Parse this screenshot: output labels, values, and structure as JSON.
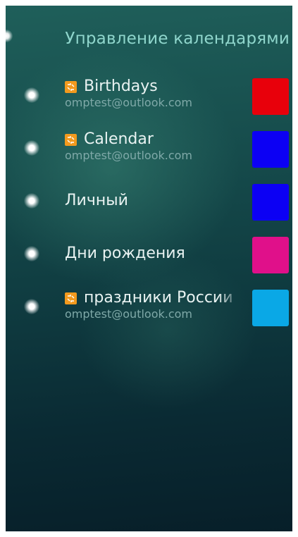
{
  "header": {
    "title": "Управление календарями"
  },
  "calendars": [
    {
      "name": "Birthdays",
      "account": "omptest@outlook.com",
      "icon": "exchange-icon",
      "color": "#e8000b"
    },
    {
      "name": "Calendar",
      "account": "omptest@outlook.com",
      "icon": "exchange-icon",
      "color": "#0c00f4"
    },
    {
      "name": "Личный",
      "account": "",
      "icon": "",
      "color": "#0c00f4"
    },
    {
      "name": "Дни рождения",
      "account": "",
      "icon": "",
      "color": "#e0108a"
    },
    {
      "name": "праздники России",
      "account": "omptest@outlook.com",
      "icon": "exchange-icon",
      "color": "#0aa8e6"
    }
  ]
}
